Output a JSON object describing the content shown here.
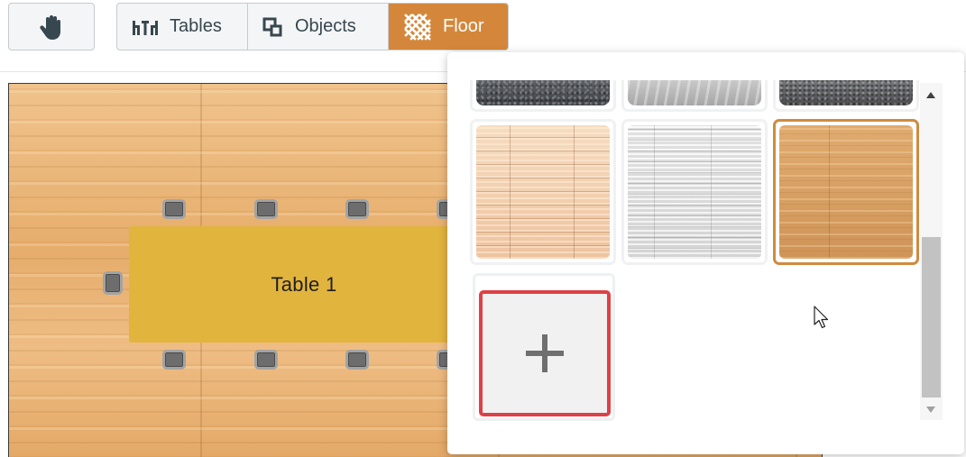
{
  "toolbar": {
    "hand_tool_icon": "hand-icon",
    "modes": [
      {
        "label": "Tables",
        "icon": "tables-icon",
        "active": false
      },
      {
        "label": "Objects",
        "icon": "objects-icon",
        "active": false
      },
      {
        "label": "Floor",
        "icon": "floor-icon",
        "active": true
      }
    ],
    "active_color": "#d4873a"
  },
  "canvas": {
    "floor_texture": "light-bamboo-wood",
    "table": {
      "label": "Table 1",
      "color": "#e1b43e"
    }
  },
  "floor_picker": {
    "textures": [
      {
        "name": "dark-speckled-stone",
        "selected": false
      },
      {
        "name": "silver-brushed-metal",
        "selected": false
      },
      {
        "name": "dark-granite",
        "selected": false
      },
      {
        "name": "light-maple-planks",
        "selected": false
      },
      {
        "name": "whitewashed-wood-planks",
        "selected": false
      },
      {
        "name": "bamboo-wood",
        "selected": true
      }
    ],
    "add_button_icon": "plus-icon",
    "selected_border_color": "#d08a3e",
    "add_button_border_color": "#dd4146"
  }
}
